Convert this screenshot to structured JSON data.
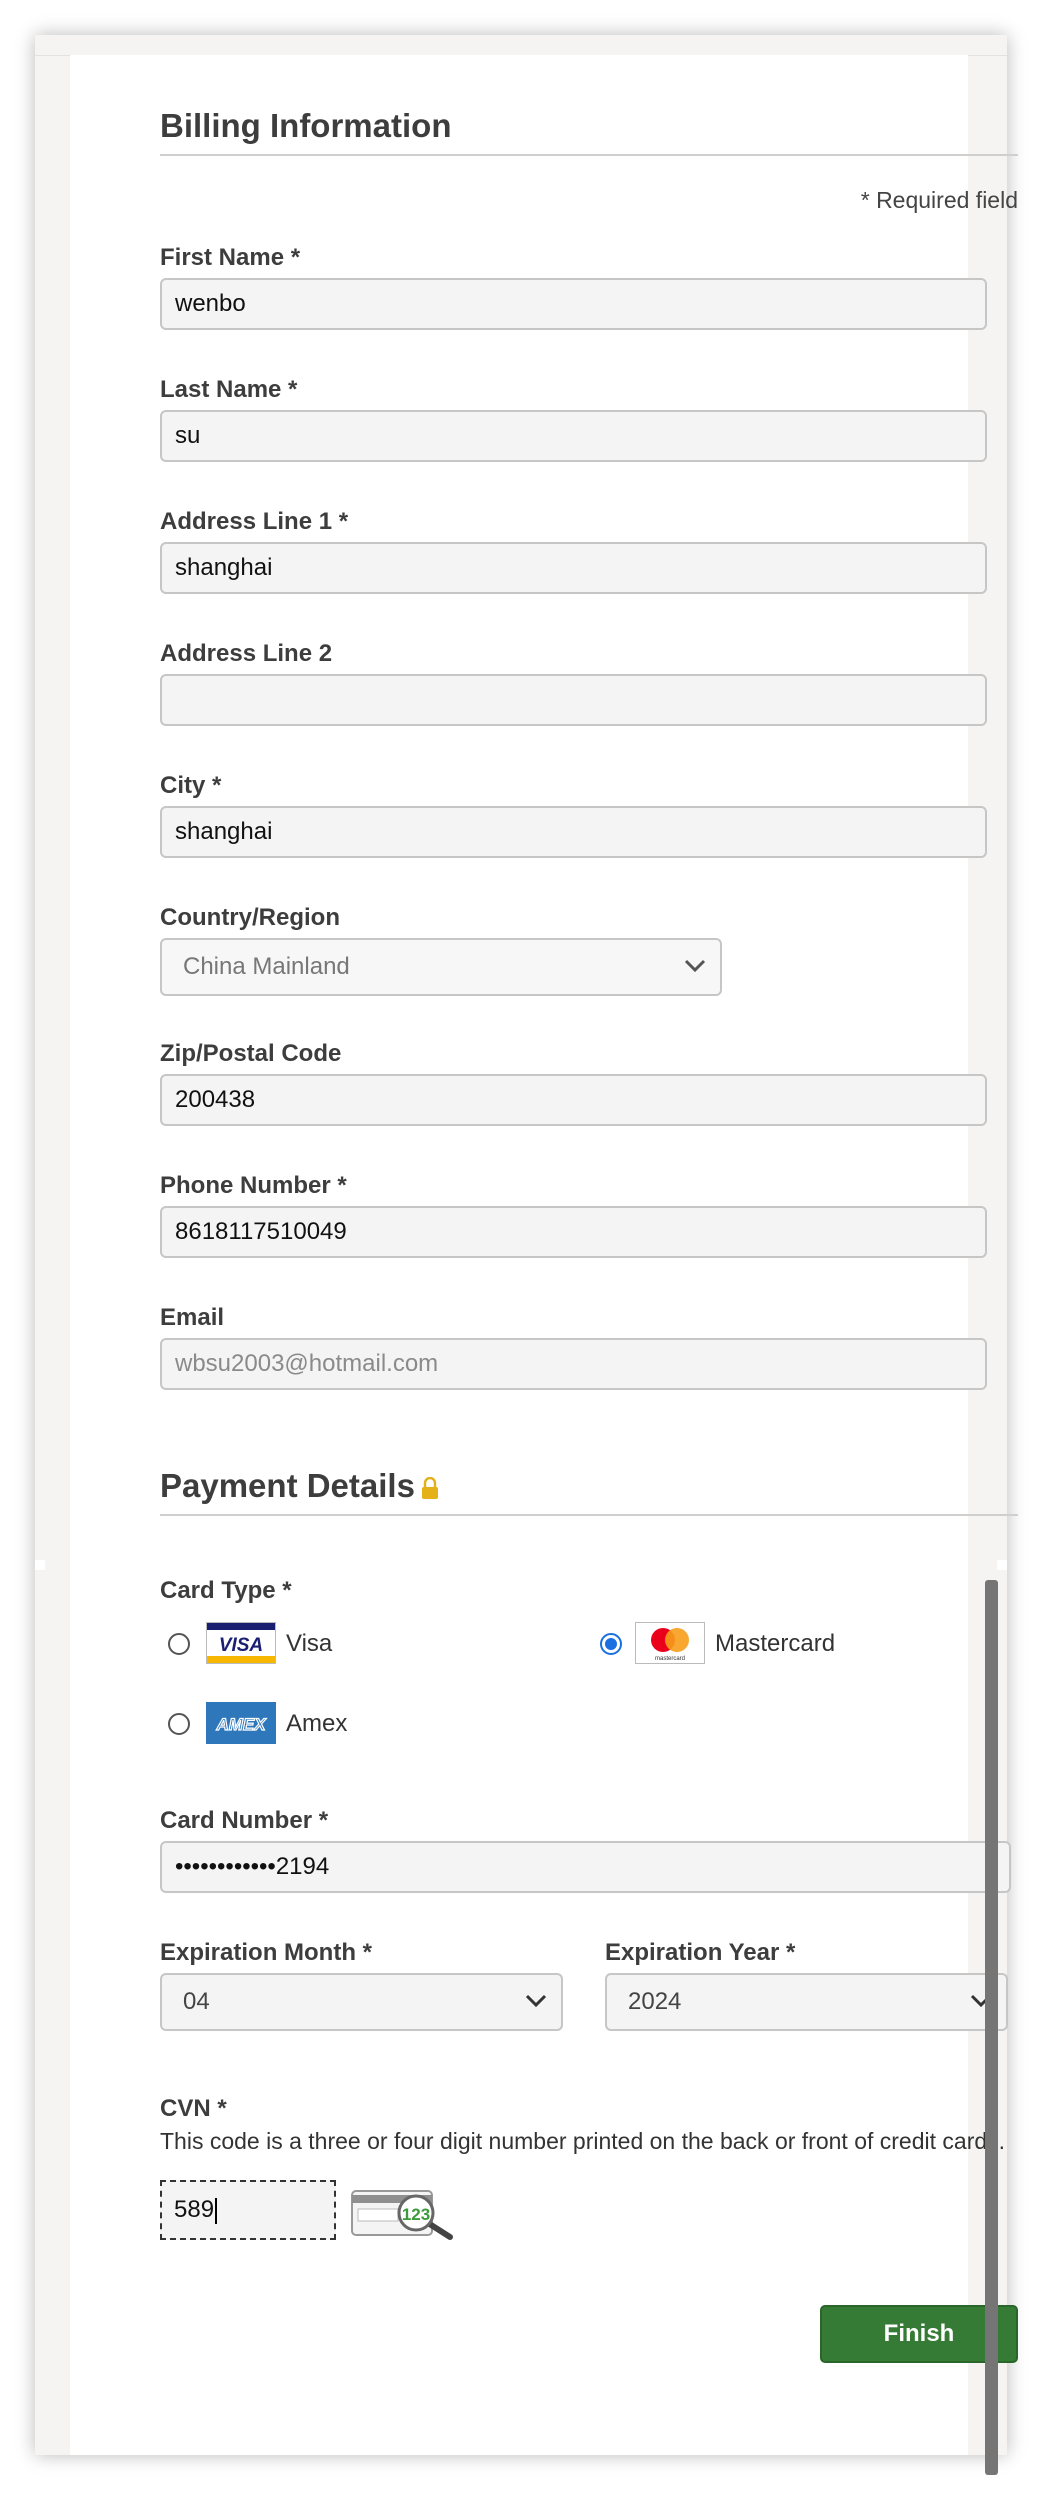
{
  "billing": {
    "title": "Billing Information",
    "required_note": "* Required field",
    "fields": {
      "first_name": {
        "label": "First Name *",
        "value": "wenbo"
      },
      "last_name": {
        "label": "Last Name *",
        "value": "su"
      },
      "address1": {
        "label": "Address Line 1 *",
        "value": "shanghai"
      },
      "address2": {
        "label": "Address Line 2",
        "value": ""
      },
      "city": {
        "label": "City *",
        "value": "shanghai"
      },
      "country": {
        "label": "Country/Region",
        "value": "China Mainland"
      },
      "zip": {
        "label": "Zip/Postal Code",
        "value": "200438"
      },
      "phone": {
        "label": "Phone Number *",
        "value": "8618117510049"
      },
      "email": {
        "label": "Email",
        "placeholder": "wbsu2003@hotmail.com"
      }
    }
  },
  "payment": {
    "title": "Payment Details",
    "card_type_label": "Card Type *",
    "card_types": [
      {
        "name": "Visa",
        "logo_text": "VISA",
        "selected": false
      },
      {
        "name": "Mastercard",
        "logo_text": "mastercard",
        "selected": true
      },
      {
        "name": "Amex",
        "logo_text": "AMEX",
        "selected": false
      }
    ],
    "card_number": {
      "label": "Card Number *",
      "value": "••••••••••••2194"
    },
    "exp_month": {
      "label": "Expiration Month *",
      "value": "04"
    },
    "exp_year": {
      "label": "Expiration Year *",
      "value": "2024"
    },
    "cvn": {
      "label": "CVN *",
      "help": "This code is a three or four digit number printed on the back or front of credit cards.",
      "value": "589",
      "image_digits": "123"
    },
    "finish_label": "Finish"
  },
  "colors": {
    "accent": "#357a35",
    "radio_selected": "#1b6fe0",
    "lock": "#e5b118"
  }
}
